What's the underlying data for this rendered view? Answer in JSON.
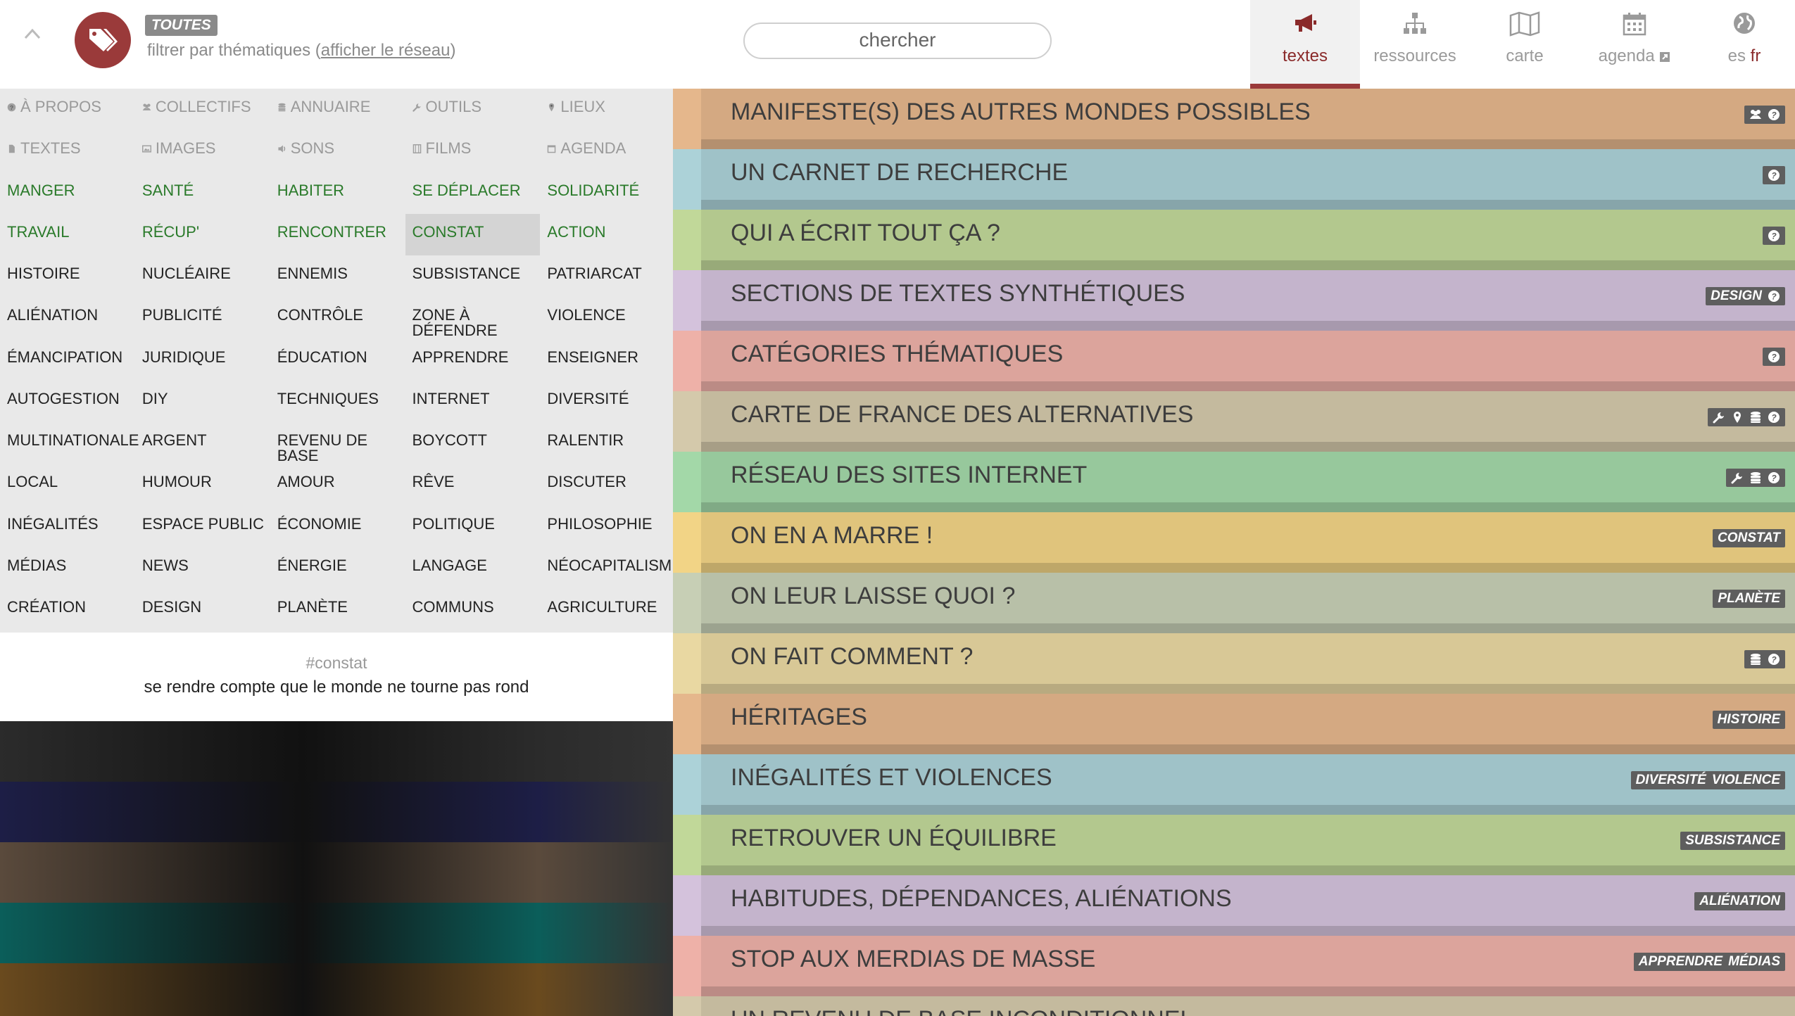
{
  "header": {
    "filter_badge": "TOUTES",
    "filter_text": "filtrer par thématiques (",
    "filter_link": "afficher le réseau",
    "filter_text_end": ")",
    "search_placeholder": "chercher",
    "nav": [
      {
        "label": "textes",
        "icon": "megaphone-icon",
        "active": true
      },
      {
        "label": "ressources",
        "icon": "sitemap-icon",
        "active": false
      },
      {
        "label": "carte",
        "icon": "map-icon",
        "active": false
      },
      {
        "label": "agenda",
        "icon": "calendar-icon",
        "active": false
      }
    ],
    "lang_es": "es",
    "lang_fr": "fr"
  },
  "categories": {
    "meta_rows": [
      [
        "À PROPOS",
        "COLLECTIFS",
        "ANNUAIRE",
        "OUTILS",
        "LIEUX"
      ],
      [
        "TEXTES",
        "IMAGES",
        "SONS",
        "FILMS",
        "AGENDA"
      ]
    ],
    "meta_icons": [
      [
        "question-icon",
        "users-icon",
        "database-icon",
        "wrench-icon",
        "pin-icon"
      ],
      [
        "file-icon",
        "image-icon",
        "volume-icon",
        "film-icon",
        "calendar-icon"
      ]
    ],
    "green_rows": [
      [
        "MANGER",
        "SANTÉ",
        "HABITER",
        "SE DÉPLACER",
        "SOLIDARITÉ"
      ],
      [
        "TRAVAIL",
        "RÉCUP'",
        "RENCONTRER",
        "CONSTAT",
        "ACTION"
      ]
    ],
    "selected": "CONSTAT",
    "topic_rows": [
      [
        "HISTOIRE",
        "NUCLÉAIRE",
        "ENNEMIS",
        "SUBSISTANCE",
        "PATRIARCAT"
      ],
      [
        "ALIÉNATION",
        "PUBLICITÉ",
        "CONTRÔLE",
        "ZONE À DÉFENDRE",
        "VIOLENCE"
      ],
      [
        "ÉMANCIPATION",
        "JURIDIQUE",
        "ÉDUCATION",
        "APPRENDRE",
        "ENSEIGNER"
      ],
      [
        "AUTOGESTION",
        "DIY",
        "TECHNIQUES",
        "INTERNET",
        "DIVERSITÉ"
      ],
      [
        "MULTINATIONALE",
        "ARGENT",
        "REVENU DE BASE",
        "BOYCOTT",
        "RALENTIR"
      ],
      [
        "LOCAL",
        "HUMOUR",
        "AMOUR",
        "RÊVE",
        "DISCUTER"
      ],
      [
        "INÉGALITÉS",
        "ESPACE PUBLIC",
        "ÉCONOMIE",
        "POLITIQUE",
        "PHILOSOPHIE"
      ],
      [
        "MÉDIAS",
        "NEWS",
        "ÉNERGIE",
        "LANGAGE",
        "NÉOCAPITALISME"
      ],
      [
        "CRÉATION",
        "DESIGN",
        "PLANÈTE",
        "COMMUNS",
        "AGRICULTURE"
      ]
    ]
  },
  "description": {
    "hashtag": "#constat",
    "text": "se rendre compte que le monde ne tourne pas rond"
  },
  "image_strip_colors": [
    "#2b2b2b",
    "#1d1e46",
    "#5a4a3c",
    "#0b5e5a",
    "#6a4a1e"
  ],
  "articles": [
    {
      "title": "MANIFESTE(S) DES AUTRES MONDES POSSIBLES",
      "color": "#d4a982",
      "tags": [],
      "icons": [
        "users-icon",
        "question-icon"
      ]
    },
    {
      "title": "UN CARNET DE RECHERCHE",
      "color": "#9fc2c8",
      "tags": [],
      "icons": [
        "question-icon"
      ]
    },
    {
      "title": "QUI A ÉCRIT TOUT ÇA ?",
      "color": "#b3c88e",
      "tags": [],
      "icons": [
        "question-icon"
      ]
    },
    {
      "title": "SECTIONS DE TEXTES SYNTHÉTIQUES",
      "color": "#c4b4cc",
      "tags": [
        "DESIGN"
      ],
      "icons": [
        "question-icon"
      ]
    },
    {
      "title": "CATÉGORIES THÉMATIQUES",
      "color": "#dca49c",
      "tags": [],
      "icons": [
        "question-icon"
      ]
    },
    {
      "title": "CARTE DE FRANCE DES ALTERNATIVES",
      "color": "#c4ba9e",
      "tags": [],
      "icons": [
        "wrench-icon",
        "pin-icon",
        "database-icon",
        "question-icon"
      ]
    },
    {
      "title": "RÉSEAU DES SITES INTERNET",
      "color": "#97c89c",
      "tags": [],
      "icons": [
        "wrench-icon",
        "database-icon",
        "question-icon"
      ]
    },
    {
      "title": "ON EN A MARRE !",
      "color": "#e0c47c",
      "tags": [
        "CONSTAT"
      ],
      "icons": []
    },
    {
      "title": "ON LEUR LAISSE QUOI ?",
      "color": "#b8c0a8",
      "tags": [
        "PLANÈTE"
      ],
      "icons": []
    },
    {
      "title": "ON FAIT COMMENT ?",
      "color": "#d8c896",
      "tags": [],
      "icons": [
        "database-icon",
        "question-icon"
      ]
    },
    {
      "title": "HÉRITAGES",
      "color": "#d4a982",
      "tags": [
        "HISTOIRE"
      ],
      "icons": []
    },
    {
      "title": "INÉGALITÉS ET VIOLENCES",
      "color": "#9fc2c8",
      "tags": [
        "DIVERSITÉ",
        "VIOLENCE"
      ],
      "icons": []
    },
    {
      "title": "RETROUVER UN ÉQUILIBRE",
      "color": "#b3c88e",
      "tags": [
        "SUBSISTANCE"
      ],
      "icons": []
    },
    {
      "title": "HABITUDES, DÉPENDANCES, ALIÉNATIONS",
      "color": "#c4b4cc",
      "tags": [
        "ALIÉNATION"
      ],
      "icons": []
    },
    {
      "title": "STOP AUX MERDIAS DE MASSE",
      "color": "#dca49c",
      "tags": [
        "APPRENDRE",
        "MÉDIAS"
      ],
      "icons": []
    },
    {
      "title": "UN REVENU DE BASE INCONDITIONNEL",
      "color": "#c4ba9e",
      "tags": [],
      "icons": []
    }
  ]
}
